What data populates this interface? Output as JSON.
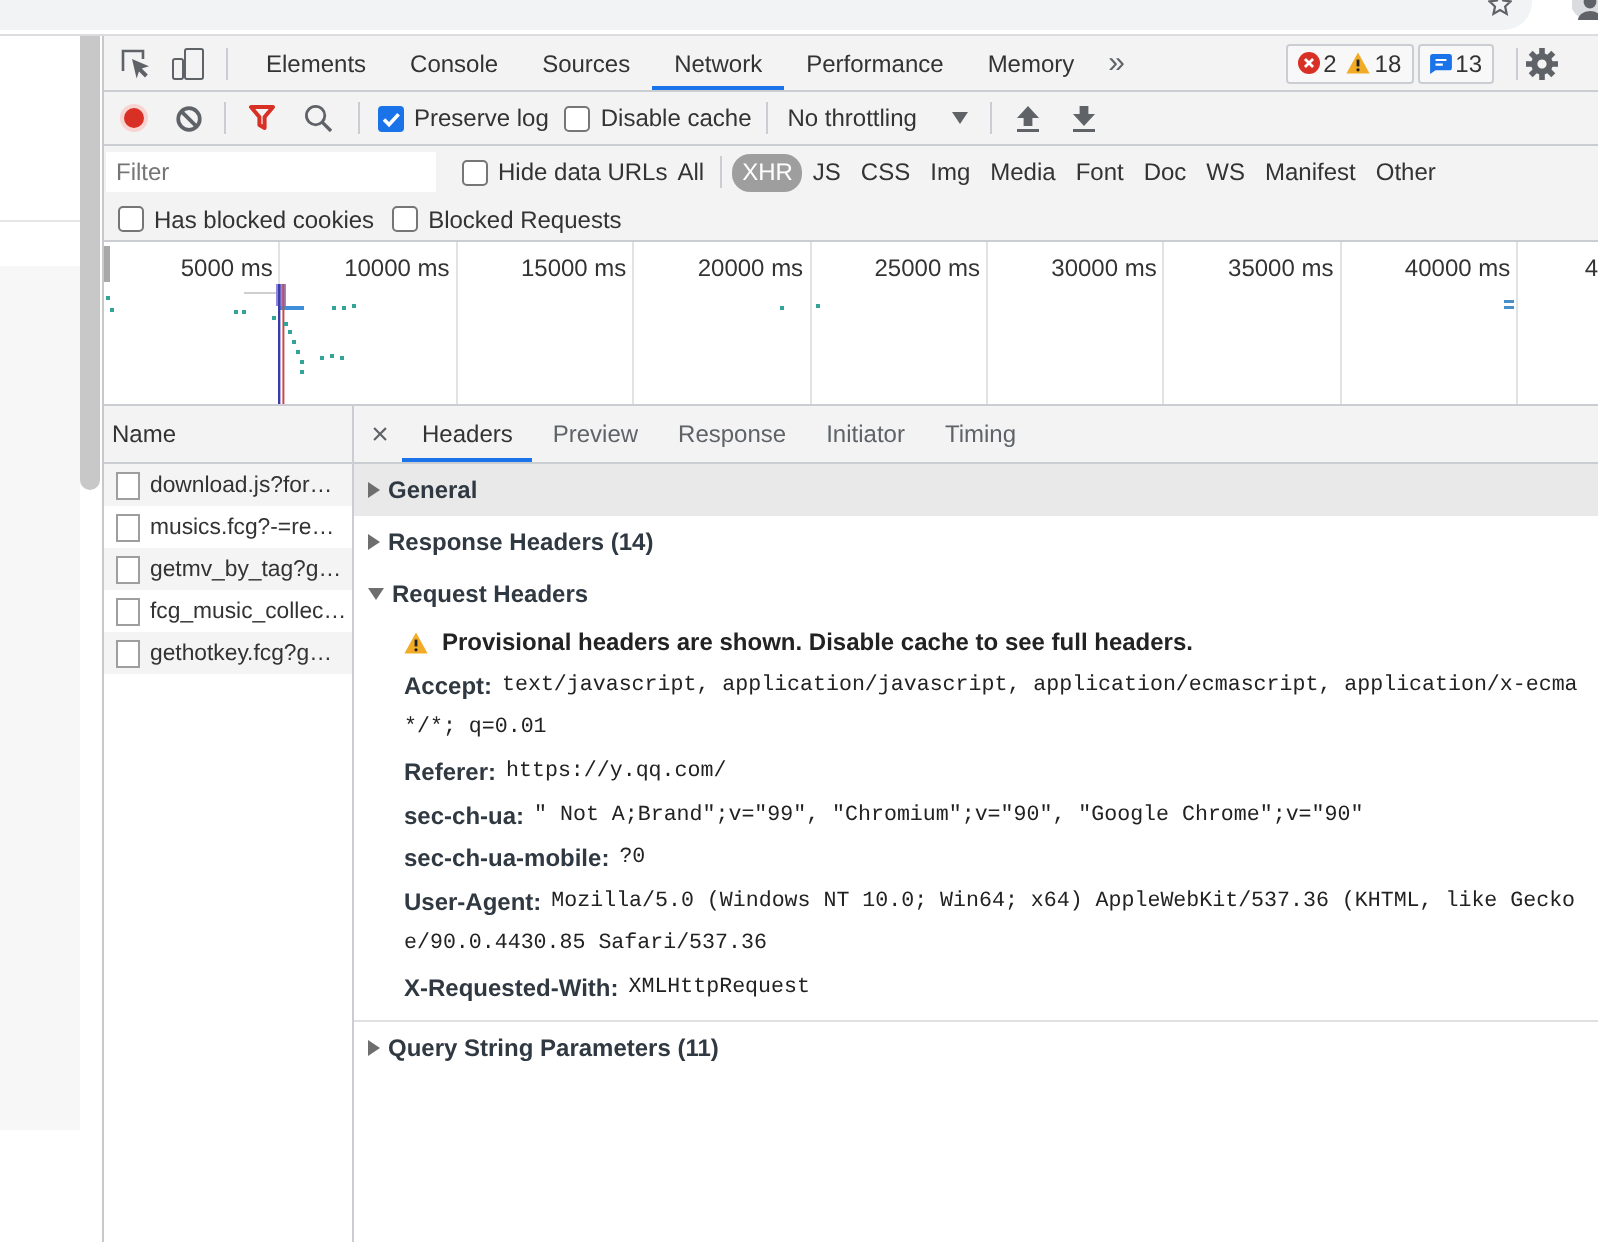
{
  "devtools": {
    "tabs": [
      {
        "label": "Elements",
        "selected": false
      },
      {
        "label": "Console",
        "selected": false
      },
      {
        "label": "Sources",
        "selected": false
      },
      {
        "label": "Network",
        "selected": true
      },
      {
        "label": "Performance",
        "selected": false
      },
      {
        "label": "Memory",
        "selected": false
      }
    ],
    "more_tabs": "»",
    "counter_groups": [
      {
        "counters": [
          {
            "kind": "error",
            "count": "2"
          },
          {
            "kind": "warning",
            "count": "18"
          }
        ]
      },
      {
        "counters": [
          {
            "kind": "message",
            "count": "13"
          }
        ]
      }
    ]
  },
  "network": {
    "toolbar": {
      "recording": true,
      "filter_active": true,
      "options": [
        {
          "label": "Preserve log",
          "checked": true
        },
        {
          "label": "Disable cache",
          "checked": false
        }
      ],
      "throttling": "No throttling"
    },
    "filter_bar": {
      "placeholder": "Filter",
      "options": [
        {
          "label": "Hide data URLs",
          "checked": false
        }
      ],
      "types": [
        {
          "label": "All",
          "selected": false
        },
        {
          "label": "XHR",
          "selected": true
        },
        {
          "label": "JS",
          "selected": false
        },
        {
          "label": "CSS",
          "selected": false
        },
        {
          "label": "Img",
          "selected": false
        },
        {
          "label": "Media",
          "selected": false
        },
        {
          "label": "Font",
          "selected": false
        },
        {
          "label": "Doc",
          "selected": false
        },
        {
          "label": "WS",
          "selected": false
        },
        {
          "label": "Manifest",
          "selected": false
        },
        {
          "label": "Other",
          "selected": false
        }
      ],
      "blocked_filters": [
        {
          "label": "Has blocked cookies",
          "checked": false
        },
        {
          "label": "Blocked Requests",
          "checked": false
        }
      ]
    },
    "overview": {
      "ticks": [
        "5000 ms",
        "10000 ms",
        "15000 ms",
        "20000 ms",
        "25000 ms",
        "30000 ms",
        "35000 ms",
        "40000 ms",
        "4"
      ]
    },
    "requests": {
      "column": "Name",
      "rows": [
        {
          "name": "download.js?for…"
        },
        {
          "name": "musics.fcg?-=re…"
        },
        {
          "name": "getmv_by_tag?g…"
        },
        {
          "name": "fcg_music_collec…"
        },
        {
          "name": "gethotkey.fcg?g…"
        }
      ]
    },
    "detail": {
      "close": "×",
      "tabs": [
        {
          "label": "Headers",
          "selected": true
        },
        {
          "label": "Preview",
          "selected": false
        },
        {
          "label": "Response",
          "selected": false
        },
        {
          "label": "Initiator",
          "selected": false
        },
        {
          "label": "Timing",
          "selected": false
        }
      ],
      "sections": [
        {
          "title": "General",
          "expanded": false,
          "highlighted": true
        },
        {
          "title": "Response Headers (14)",
          "expanded": false,
          "highlighted": false
        },
        {
          "title": "Request Headers",
          "expanded": true,
          "highlighted": false,
          "warning": "Provisional headers are shown. Disable cache to see full headers.",
          "headers": [
            {
              "name": "Accept:",
              "value_lines": [
                "text/javascript, application/javascript, application/ecmascript, application/x-ecma",
                "*/*; q=0.01"
              ]
            },
            {
              "name": "Referer:",
              "value_lines": [
                "https://y.qq.com/"
              ]
            },
            {
              "name": "sec-ch-ua:",
              "value_lines": [
                "\" Not A;Brand\";v=\"99\", \"Chromium\";v=\"90\", \"Google Chrome\";v=\"90\""
              ]
            },
            {
              "name": "sec-ch-ua-mobile:",
              "value_lines": [
                "?0"
              ]
            },
            {
              "name": "User-Agent:",
              "value_lines": [
                "Mozilla/5.0 (Windows NT 10.0; Win64; x64) AppleWebKit/537.36 (KHTML, like Gecko",
                "e/90.0.4430.85 Safari/537.36"
              ]
            },
            {
              "name": "X-Requested-With:",
              "value_lines": [
                "XMLHttpRequest"
              ]
            }
          ]
        },
        {
          "title": "Query String Parameters (11)",
          "expanded": false,
          "highlighted": false
        }
      ]
    }
  }
}
